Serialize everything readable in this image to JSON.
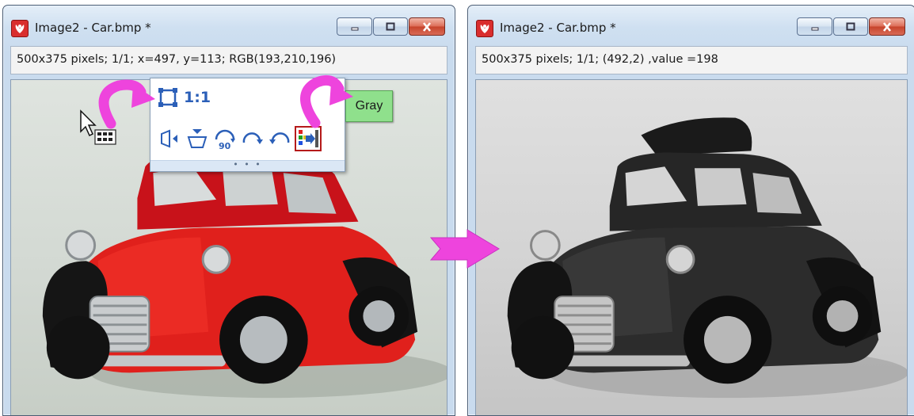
{
  "windows": {
    "left": {
      "title": "Image2 - Car.bmp *",
      "status": "500x375 pixels; 1/1; x=497, y=113; RGB(193,210,196)",
      "image_kind": "color"
    },
    "right": {
      "title": "Image2 - Car.bmp *",
      "status": "500x375 pixels; 1/1; (492,2) ,value =198",
      "image_kind": "grayscale"
    }
  },
  "toolbar": {
    "fit_icon": "fit-to-window-icon",
    "one_to_one_label": "1:1",
    "row2_icons": [
      "flip-horizontal-icon",
      "flip-vertical-icon",
      "rotate-90-icon",
      "rotate-clockwise-icon",
      "rotate-counterclockwise-icon",
      "convert-to-gray-icon"
    ],
    "rotate_label": "90",
    "footer": "• • •"
  },
  "gray_badge": "Gray",
  "colors": {
    "accent_magenta": "#ee44dd",
    "gray_badge": "#8fe08c",
    "toolbar_icon_blue": "#2b5fb8",
    "car_red": "#e0201c"
  },
  "icons": {
    "app": "app-logo-icon",
    "minimize": "minimize-icon",
    "maximize": "maximize-icon",
    "close": "close-icon",
    "cursor": "cursor-with-toolbar-icon",
    "arrow": "right-arrow-icon"
  }
}
